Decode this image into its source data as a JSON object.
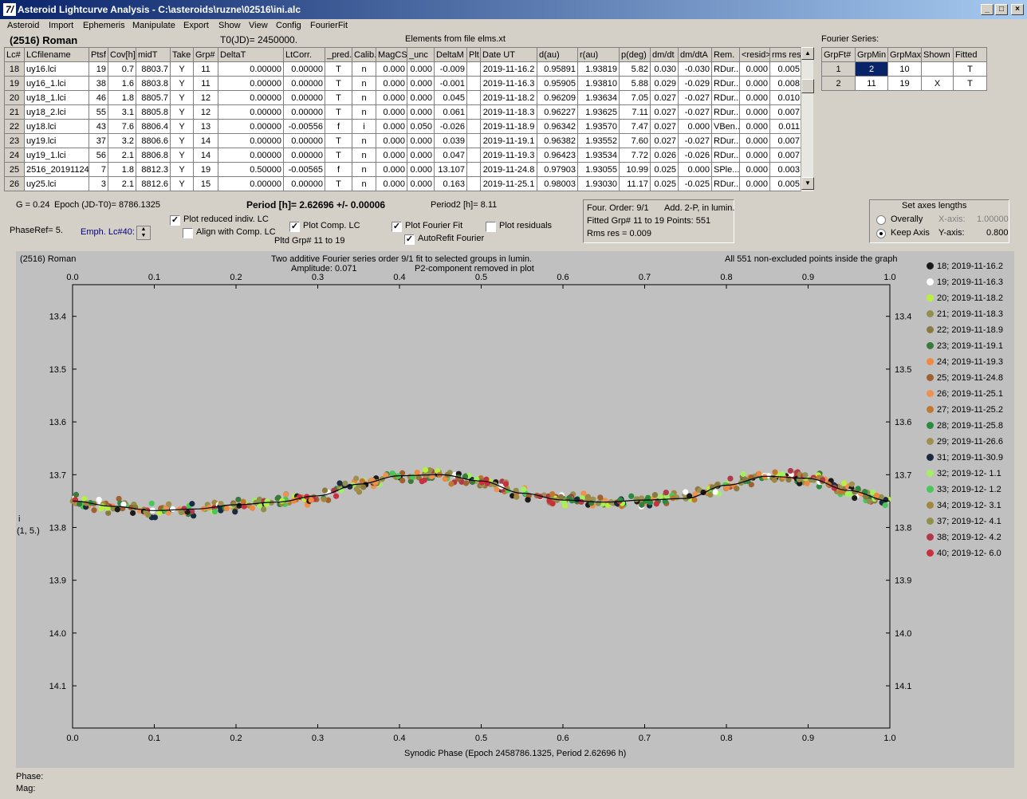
{
  "window": {
    "icon_glyph": "7/",
    "title": "Asteroid Lightcurve Analysis - C:\\asteroids\\ruzne\\02516\\ini.alc",
    "minimize": "_",
    "maximize": "□",
    "close": "×"
  },
  "menu": [
    "Asteroid",
    "Import",
    "Ephemeris",
    "Manipulate",
    "Export",
    "Show",
    "View",
    "Config",
    "FourierFit"
  ],
  "header": {
    "asteroid": "(2516) Roman",
    "t0": "T0(JD)= 2450000.",
    "elements": "Elements from file elms.xt",
    "fourier_series": "Fourier Series:"
  },
  "lc_table": {
    "columns": [
      "Lc#",
      "LCfilename",
      "Ptsf",
      "Cov[h]",
      "midT",
      "Take",
      "Grp#",
      "DeltaT",
      "LtCorr.",
      "_pred.",
      "Calib.",
      "MagCS",
      "_unc",
      "DeltaM",
      "Plt",
      "Date UT",
      "d(au)",
      "r(au)",
      "p(deg)",
      "dm/dt",
      "dm/dtA",
      "Rem.",
      "<resid>",
      "rms res"
    ],
    "rows": [
      [
        "18",
        "uy16.lci",
        "19",
        "0.7",
        "8803.7",
        "Y",
        "11",
        "0.00000",
        "0.00000",
        "T",
        "n",
        "0.000",
        "0.000",
        "-0.009",
        "",
        "2019-11-16.2",
        "0.95891",
        "1.93819",
        "5.82",
        "0.030",
        "-0.030",
        "RDur...",
        "0.000",
        "0.005"
      ],
      [
        "19",
        "uy16_1.lci",
        "38",
        "1.6",
        "8803.8",
        "Y",
        "11",
        "0.00000",
        "0.00000",
        "T",
        "n",
        "0.000",
        "0.000",
        "-0.001",
        "",
        "2019-11-16.3",
        "0.95905",
        "1.93810",
        "5.88",
        "0.029",
        "-0.029",
        "RDur...",
        "0.000",
        "0.008"
      ],
      [
        "20",
        "uy18_1.lci",
        "46",
        "1.8",
        "8805.7",
        "Y",
        "12",
        "0.00000",
        "0.00000",
        "T",
        "n",
        "0.000",
        "0.000",
        "0.045",
        "",
        "2019-11-18.2",
        "0.96209",
        "1.93634",
        "7.05",
        "0.027",
        "-0.027",
        "RDur...",
        "0.000",
        "0.010"
      ],
      [
        "21",
        "uy18_2.lci",
        "55",
        "3.1",
        "8805.8",
        "Y",
        "12",
        "0.00000",
        "0.00000",
        "T",
        "n",
        "0.000",
        "0.000",
        "0.061",
        "",
        "2019-11-18.3",
        "0.96227",
        "1.93625",
        "7.11",
        "0.027",
        "-0.027",
        "RDur...",
        "0.000",
        "0.007"
      ],
      [
        "22",
        "uy18.lci",
        "43",
        "7.6",
        "8806.4",
        "Y",
        "13",
        "0.00000",
        "-0.00556",
        "f",
        "i",
        "0.000",
        "0.050",
        "-0.026",
        "",
        "2019-11-18.9",
        "0.96342",
        "1.93570",
        "7.47",
        "0.027",
        "0.000",
        "VBen...",
        "0.000",
        "0.011"
      ],
      [
        "23",
        "uy19.lci",
        "37",
        "3.2",
        "8806.6",
        "Y",
        "14",
        "0.00000",
        "0.00000",
        "T",
        "n",
        "0.000",
        "0.000",
        "0.039",
        "",
        "2019-11-19.1",
        "0.96382",
        "1.93552",
        "7.60",
        "0.027",
        "-0.027",
        "RDur...",
        "0.000",
        "0.007"
      ],
      [
        "24",
        "uy19_1.lci",
        "56",
        "2.1",
        "8806.8",
        "Y",
        "14",
        "0.00000",
        "0.00000",
        "T",
        "n",
        "0.000",
        "0.000",
        "0.047",
        "",
        "2019-11-19.3",
        "0.96423",
        "1.93534",
        "7.72",
        "0.026",
        "-0.026",
        "RDur...",
        "0.000",
        "0.007"
      ],
      [
        "25",
        "2516_20191124",
        "7",
        "1.8",
        "8812.3",
        "Y",
        "19",
        "0.50000",
        "-0.00565",
        "f",
        "n",
        "0.000",
        "0.000",
        "13.107",
        "",
        "2019-11-24.8",
        "0.97903",
        "1.93055",
        "10.99",
        "0.025",
        "0.000",
        "SPle...",
        "0.000",
        "0.003"
      ],
      [
        "26",
        "uy25.lci",
        "3",
        "2.1",
        "8812.6",
        "Y",
        "15",
        "0.00000",
        "0.00000",
        "T",
        "n",
        "0.000",
        "0.000",
        "0.163",
        "",
        "2019-11-25.1",
        "0.98003",
        "1.93030",
        "11.17",
        "0.025",
        "-0.025",
        "RDur...",
        "0.000",
        "0.005"
      ]
    ]
  },
  "fourier_table": {
    "columns": [
      "GrpFt#",
      "GrpMin",
      "GrpMax",
      "Shown",
      "Fitted"
    ],
    "rows": [
      [
        "1",
        "2",
        "10",
        "",
        "T"
      ],
      [
        "2",
        "11",
        "19",
        "X",
        "T"
      ]
    ]
  },
  "params": {
    "g": "G = 0.24",
    "epoch": "Epoch (JD-T0)= 8786.1325",
    "period": "Period [h]= 2.62696 +/- 0.00006",
    "period2": "Period2 [h]= 8.11",
    "phaseref": "PhaseRef= 5.",
    "emph": "Emph. Lc#40:",
    "pltd_grp": "Pltd Grp#  11 to   19"
  },
  "checkboxes": {
    "plot_reduced": {
      "label": "Plot reduced indiv. LC",
      "checked": true
    },
    "align_comp": {
      "label": "Align with Comp. LC",
      "checked": false
    },
    "plot_comp": {
      "label": "Plot Comp. LC",
      "checked": true
    },
    "plot_fourier": {
      "label": "Plot Fourier Fit",
      "checked": true
    },
    "autorefit": {
      "label": "AutoRefit Fourier",
      "checked": true
    },
    "plot_residuals": {
      "label": "Plot residuals",
      "checked": false
    },
    "check_glyph": "✓"
  },
  "fit_info": {
    "four_order": "Four. Order:  9/1",
    "add": "Add. 2-P, in lumin.",
    "fitted": "Fitted Grp# 11 to 19 Points: 551",
    "rms": "Rms res      = 0.009"
  },
  "axes_panel": {
    "title": "Set axes lengths",
    "overally": "Overally",
    "keep_axis": "Keep Axis",
    "selected": "keep_axis",
    "x_axis_label": "X-axis:",
    "x_axis_value": "1.00000",
    "y_axis_label": "Y-axis:",
    "y_axis_value": "0.800"
  },
  "plot": {
    "top_left": "(2516) Roman",
    "caption1": "Two additive Fourier series order 9/1 fit to selected groups in lumin.",
    "amplitude": "Amplitude: 0.071",
    "p2": "P2-component removed in plot",
    "top_right": "All 551 non-excluded points inside the graph",
    "ylabel1": "i",
    "ylabel2": "(1, 5.)",
    "xlabel": "Synodic Phase (Epoch 2458786.1325, Period 2.62696 h)"
  },
  "chart_data": {
    "type": "scatter",
    "xlim": [
      0.0,
      1.0
    ],
    "ylim": [
      14.18,
      13.34
    ],
    "x_ticks": [
      "0.0",
      "0.1",
      "0.2",
      "0.3",
      "0.4",
      "0.5",
      "0.6",
      "0.7",
      "0.8",
      "0.9",
      "1.0"
    ],
    "y_ticks": [
      "13.4",
      "13.5",
      "13.6",
      "13.7",
      "13.8",
      "13.9",
      "14.0",
      "14.1"
    ],
    "y_inverted": true,
    "fit_curve": {
      "x": [
        0.0,
        0.05,
        0.1,
        0.15,
        0.2,
        0.25,
        0.3,
        0.35,
        0.4,
        0.45,
        0.5,
        0.55,
        0.6,
        0.65,
        0.7,
        0.75,
        0.8,
        0.85,
        0.9,
        0.95,
        1.0
      ],
      "y": [
        13.75,
        13.76,
        13.768,
        13.765,
        13.757,
        13.752,
        13.74,
        13.718,
        13.702,
        13.7,
        13.712,
        13.735,
        13.748,
        13.752,
        13.748,
        13.745,
        13.72,
        13.703,
        13.707,
        13.73,
        13.75
      ]
    },
    "points_total": 551,
    "legend": [
      {
        "label": "18; 2019-11-16.2",
        "color": "#1a1a1a"
      },
      {
        "label": "19; 2019-11-16.3",
        "color": "#ffffff"
      },
      {
        "label": "20; 2019-11-18.2",
        "color": "#b8f040"
      },
      {
        "label": "21; 2019-11-18.3",
        "color": "#909050"
      },
      {
        "label": "22; 2019-11-18.9",
        "color": "#8a7a40"
      },
      {
        "label": "23; 2019-11-19.1",
        "color": "#3a7a3a"
      },
      {
        "label": "24; 2019-11-19.3",
        "color": "#f08840"
      },
      {
        "label": "25; 2019-11-24.8",
        "color": "#a06030"
      },
      {
        "label": "26; 2019-11-25.1",
        "color": "#f09050"
      },
      {
        "label": "27; 2019-11-25.2",
        "color": "#c07830"
      },
      {
        "label": "28; 2019-11-25.8",
        "color": "#2a8a40"
      },
      {
        "label": "29; 2019-11-26.6",
        "color": "#a09050"
      },
      {
        "label": "31; 2019-11-30.9",
        "color": "#1a2a40"
      },
      {
        "label": "32; 2019-12- 1.1",
        "color": "#a0f060"
      },
      {
        "label": "33; 2019-12- 1.2",
        "color": "#48c858"
      },
      {
        "label": "34; 2019-12- 3.1",
        "color": "#a08840"
      },
      {
        "label": "37; 2019-12- 4.1",
        "color": "#909048"
      },
      {
        "label": "38; 2019-12- 4.2",
        "color": "#b03848"
      },
      {
        "label": "40; 2019-12- 6.0",
        "color": "#c83040"
      }
    ]
  },
  "footer": {
    "phase": "Phase:",
    "mag": "Mag:"
  }
}
